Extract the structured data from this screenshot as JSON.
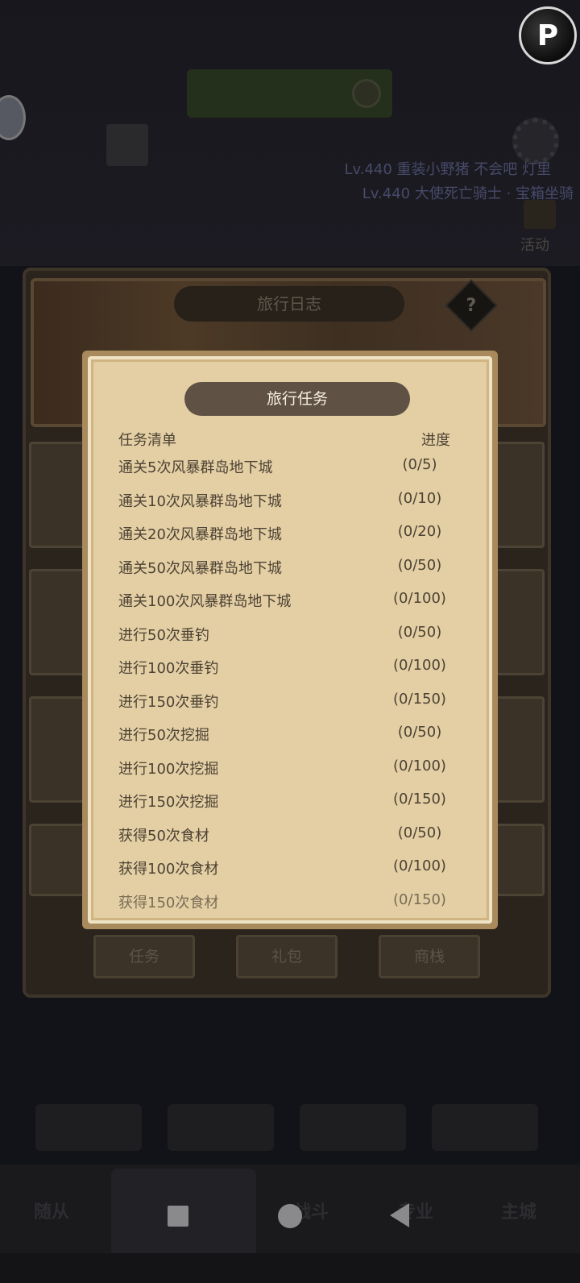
{
  "background": {
    "banner_text": "",
    "ticker_lines": [
      "Lv.440 重装小野猪  不会吧  灯里",
      "Lv.440 大使死亡骑士 · 宝箱坐骑"
    ],
    "activity_label": "活动",
    "log_panel_title": "旅行日志",
    "help_symbol": "?",
    "bottom_tabs": [
      "任务",
      "礼包",
      "商栈"
    ],
    "nav_items": [
      "随从",
      "战斗",
      "专业",
      "主城"
    ]
  },
  "modal": {
    "title": "旅行任务",
    "col_task": "任务清单",
    "col_progress": "进度",
    "tasks": [
      {
        "name": "通关5次风暴群岛地下城",
        "progress": "(0/5)"
      },
      {
        "name": "通关10次风暴群岛地下城",
        "progress": "(0/10)"
      },
      {
        "name": "通关20次风暴群岛地下城",
        "progress": "(0/20)"
      },
      {
        "name": "通关50次风暴群岛地下城",
        "progress": "(0/50)"
      },
      {
        "name": "通关100次风暴群岛地下城",
        "progress": "(0/100)"
      },
      {
        "name": "进行50次垂钓",
        "progress": "(0/50)"
      },
      {
        "name": "进行100次垂钓",
        "progress": "(0/100)"
      },
      {
        "name": "进行150次垂钓",
        "progress": "(0/150)"
      },
      {
        "name": "进行50次挖掘",
        "progress": "(0/50)"
      },
      {
        "name": "进行100次挖掘",
        "progress": "(0/100)"
      },
      {
        "name": "进行150次挖掘",
        "progress": "(0/150)"
      },
      {
        "name": "获得50次食材",
        "progress": "(0/50)"
      },
      {
        "name": "获得100次食材",
        "progress": "(0/100)"
      },
      {
        "name": "获得150次食材",
        "progress": "(0/150)"
      }
    ]
  },
  "colors": {
    "modal_bg": "#e4cfa5",
    "modal_frame": "#a88a5d",
    "title_pill": "#5f5245",
    "text": "#4c4233"
  }
}
